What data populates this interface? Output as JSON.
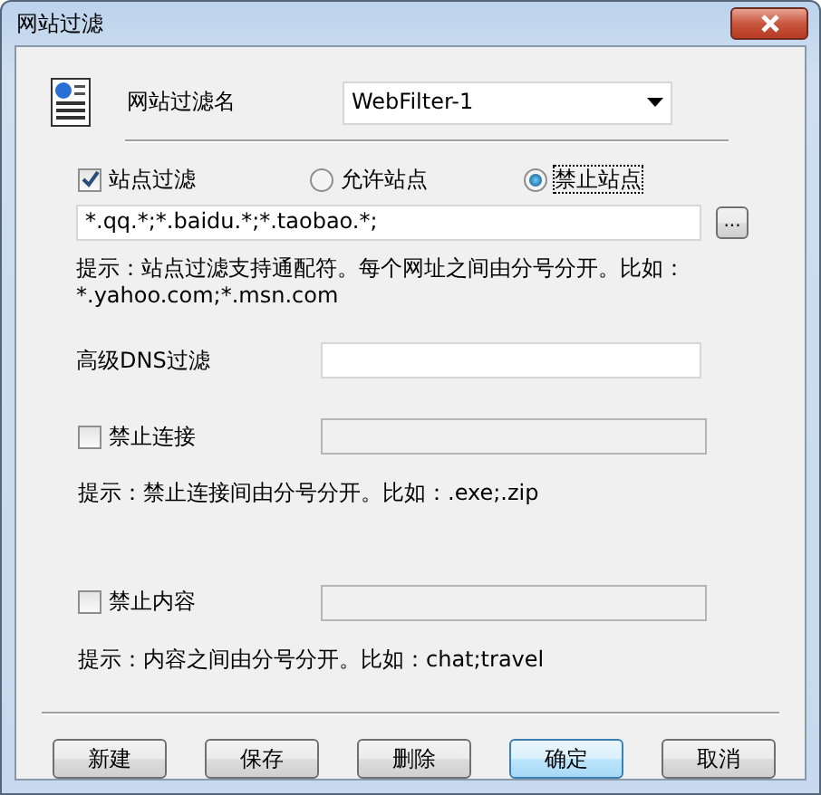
{
  "window": {
    "title": "网站过滤"
  },
  "name_field": {
    "label": "网站过滤名",
    "value": "WebFilter-1"
  },
  "site_filter": {
    "label": "站点过滤",
    "checked": true,
    "options": [
      {
        "label": "允许站点",
        "selected": false
      },
      {
        "label": "禁止站点",
        "selected": true
      }
    ],
    "value": "*.qq.*;*.baidu.*;*.taobao.*;",
    "browse": "...",
    "hint": "提示：站点过滤支持通配符。每个网址之间由分号分开。比如：*.yahoo.com;*.msn.com"
  },
  "dns_filter": {
    "label": "高级DNS过滤"
  },
  "block_connection": {
    "label": "禁止连接",
    "checked": false,
    "hint": "提示：禁止连接间由分号分开。比如：.exe;.zip"
  },
  "block_content": {
    "label": "禁止内容",
    "checked": false,
    "hint": "提示：内容之间由分号分开。比如：chat;travel"
  },
  "buttons": [
    {
      "label": "新建",
      "default": false
    },
    {
      "label": "保存",
      "default": false
    },
    {
      "label": "删除",
      "default": false
    },
    {
      "label": "确定",
      "default": true
    },
    {
      "label": "取消",
      "default": false
    }
  ]
}
